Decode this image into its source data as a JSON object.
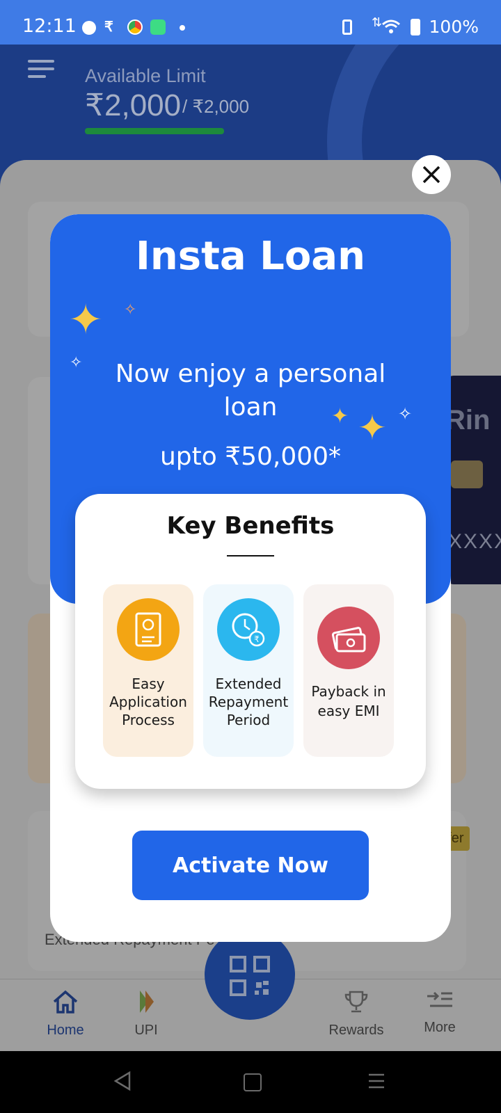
{
  "status_bar": {
    "time": "12:11",
    "battery": "100%"
  },
  "header": {
    "limit_label": "Available Limit",
    "limit_value": "₹2,000",
    "limit_total": "/ ₹2,000",
    "limit_fraction": 1.0
  },
  "background": {
    "card_partial_text": "XXXX",
    "offer_badge": "ffer",
    "promo_line": "Extended Repayment Pe        ack"
  },
  "modal": {
    "title": "Insta Loan",
    "subtitle": "Now enjoy a personal loan",
    "amount": "upto ₹50,000*",
    "benefits_title": "Key Benefits",
    "benefits": [
      {
        "label": "Easy Application Process",
        "icon": "document-user-icon",
        "color": "#f3a513",
        "bg": "#fbeede"
      },
      {
        "label": "Extended Repayment Period",
        "icon": "clock-coins-icon",
        "color": "#2bb7ee",
        "bg": "#eff8fd"
      },
      {
        "label": "Payback in easy EMI",
        "icon": "cash-notes-icon",
        "color": "#d5505f",
        "bg": "#f8f3f1"
      }
    ],
    "cta_label": "Activate Now"
  },
  "bottom_nav": {
    "items": [
      {
        "label": "Home",
        "icon": "home-icon"
      },
      {
        "label": "UPI",
        "icon": "upi-icon"
      },
      {
        "label": "Rewards",
        "icon": "trophy-icon"
      },
      {
        "label": "More",
        "icon": "more-menu-icon"
      }
    ]
  },
  "colors": {
    "primary": "#2166e8",
    "status_bar": "#3f7be6"
  }
}
